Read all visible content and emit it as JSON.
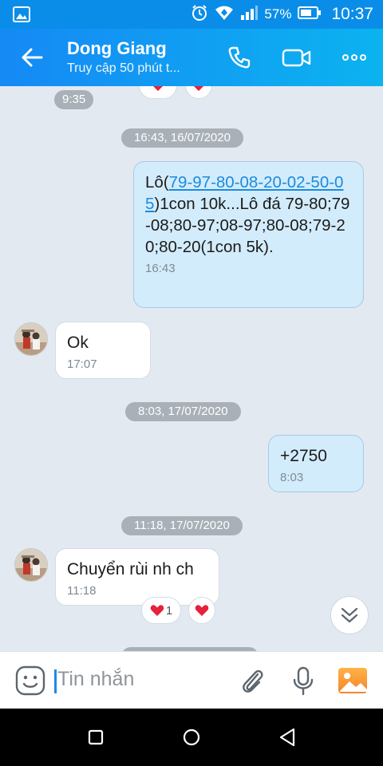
{
  "status": {
    "battery": "57%",
    "time": "10:37"
  },
  "header": {
    "title": "Dong Giang",
    "subtitle": "Truy cập 50 phút t..."
  },
  "chat": {
    "prev_time": "9:35",
    "date_1": "16:43, 16/07/2020",
    "msg_1": {
      "pre": "Lô(",
      "link": "79-97-80-08-20-02-50-05",
      "post": ")1con 10k...Lô đá 79-80;79-08;80-97;08-97;80-08;79-20;80-20(1con 5k).",
      "time": "16:43"
    },
    "msg_2": {
      "text": "Ok",
      "time": "17:07"
    },
    "date_2": "8:03, 17/07/2020",
    "msg_3": {
      "text": "+2750",
      "time": "8:03"
    },
    "date_3": "11:18, 17/07/2020",
    "msg_4": {
      "text": "Chuyển rùi nh ch",
      "time": "11:18",
      "reaction_count": "1"
    }
  },
  "composer": {
    "placeholder": "Tin nhắn"
  },
  "colors": {
    "brand": "#0a8de8",
    "out_bubble": "#d3ecfb",
    "in_bubble": "#ffffff",
    "chat_bg": "#e2e9f1"
  }
}
